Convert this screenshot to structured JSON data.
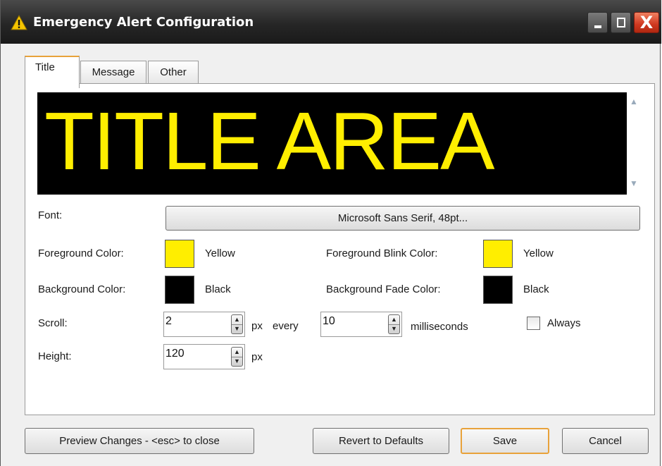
{
  "window": {
    "title": "Emergency Alert Configuration",
    "icon": "warning-icon",
    "close_glyph": "X"
  },
  "tabs": [
    {
      "label": "Title",
      "selected": true
    },
    {
      "label": "Message",
      "selected": false
    },
    {
      "label": "Other",
      "selected": false
    }
  ],
  "preview": {
    "text": "TITLE AREA",
    "foreground": "#ffee00",
    "background": "#000000"
  },
  "form": {
    "font_label": "Font:",
    "font_value": "Microsoft Sans Serif, 48pt...",
    "fg_color_label": "Foreground Color:",
    "fg_color_name": "Yellow",
    "fg_color_hex": "#ffee00",
    "fg_blink_label": "Foreground Blink Color:",
    "fg_blink_name": "Yellow",
    "fg_blink_hex": "#ffee00",
    "bg_color_label": "Background Color:",
    "bg_color_name": "Black",
    "bg_color_hex": "#000000",
    "bg_fade_label": "Background Fade Color:",
    "bg_fade_name": "Black",
    "bg_fade_hex": "#000000",
    "scroll_label": "Scroll:",
    "scroll_px": "2",
    "px_unit": "px",
    "every_label": "every",
    "scroll_ms": "10",
    "ms_unit": "milliseconds",
    "always_label": "Always",
    "always_checked": false,
    "height_label": "Height:",
    "height_value": "120",
    "height_unit": "px"
  },
  "buttons": {
    "preview": "Preview Changes - <esc> to close",
    "revert": "Revert to Defaults",
    "save": "Save",
    "cancel": "Cancel"
  }
}
